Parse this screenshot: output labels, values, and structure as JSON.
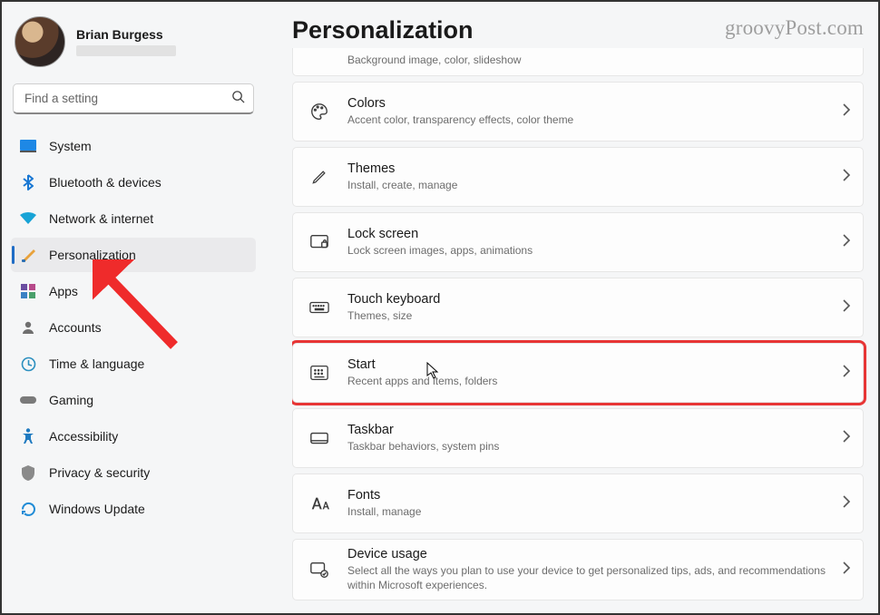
{
  "profile": {
    "name": "Brian Burgess"
  },
  "search": {
    "placeholder": "Find a setting"
  },
  "sidebar": {
    "items": [
      {
        "key": "system",
        "label": "System"
      },
      {
        "key": "bluetooth",
        "label": "Bluetooth & devices"
      },
      {
        "key": "network",
        "label": "Network & internet"
      },
      {
        "key": "personalization",
        "label": "Personalization"
      },
      {
        "key": "apps",
        "label": "Apps"
      },
      {
        "key": "accounts",
        "label": "Accounts"
      },
      {
        "key": "time",
        "label": "Time & language"
      },
      {
        "key": "gaming",
        "label": "Gaming"
      },
      {
        "key": "accessibility",
        "label": "Accessibility"
      },
      {
        "key": "privacy",
        "label": "Privacy & security"
      },
      {
        "key": "update",
        "label": "Windows Update"
      }
    ],
    "active_key": "personalization"
  },
  "page": {
    "title": "Personalization"
  },
  "watermark": "groovyPost.com",
  "stub_subtitle": "Background image, color, slideshow",
  "cards": [
    {
      "key": "colors",
      "title": "Colors",
      "sub": "Accent color, transparency effects, color theme"
    },
    {
      "key": "themes",
      "title": "Themes",
      "sub": "Install, create, manage"
    },
    {
      "key": "lock",
      "title": "Lock screen",
      "sub": "Lock screen images, apps, animations"
    },
    {
      "key": "touchkb",
      "title": "Touch keyboard",
      "sub": "Themes, size"
    },
    {
      "key": "start",
      "title": "Start",
      "sub": "Recent apps and items, folders",
      "highlight": true
    },
    {
      "key": "taskbar",
      "title": "Taskbar",
      "sub": "Taskbar behaviors, system pins"
    },
    {
      "key": "fonts",
      "title": "Fonts",
      "sub": "Install, manage"
    },
    {
      "key": "usage",
      "title": "Device usage",
      "sub": "Select all the ways you plan to use your device to get personalized tips, ads, and recommendations within Microsoft experiences."
    }
  ]
}
